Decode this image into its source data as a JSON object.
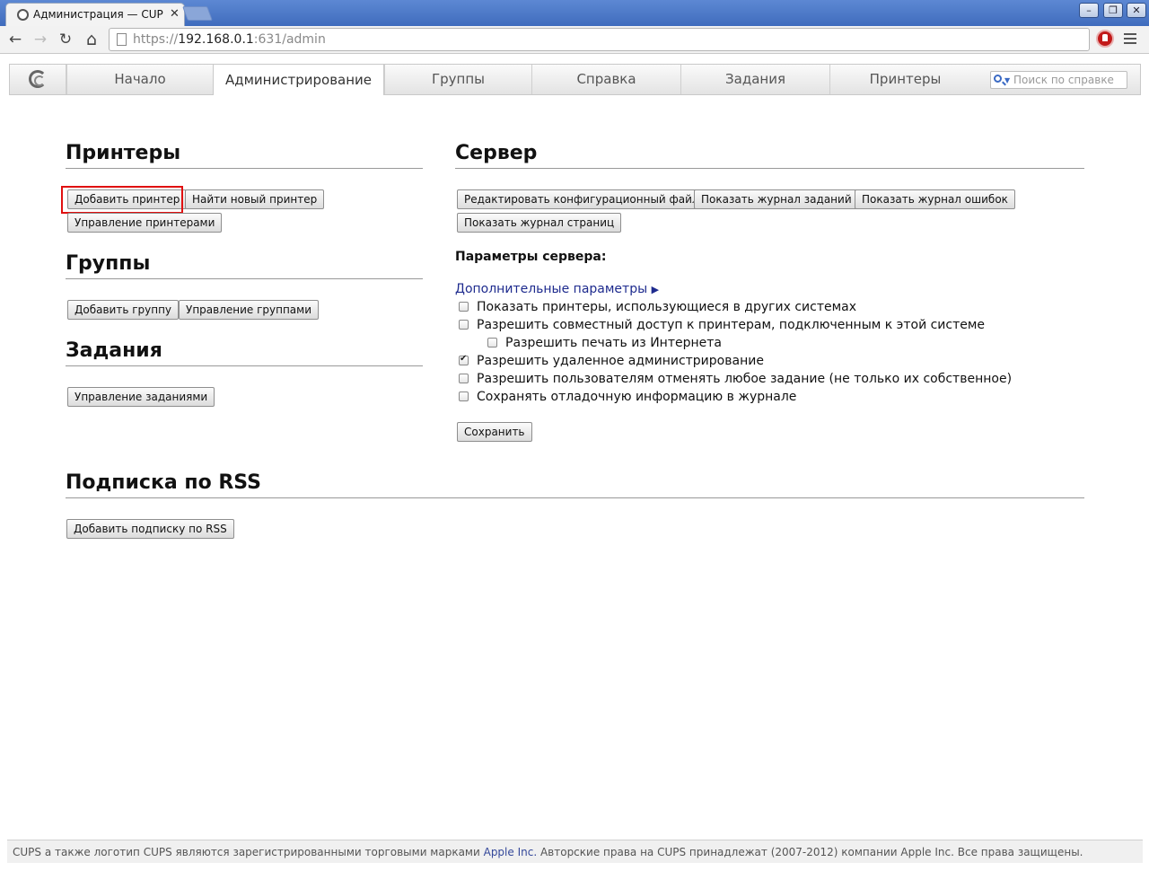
{
  "browser": {
    "tab_title": "Администрация — CUPS",
    "tab_close": "✕",
    "url_scheme": "https://",
    "url_host": "192.168.0.1",
    "url_rest": ":631/admin",
    "window_buttons": {
      "minimize": "–",
      "restore": "❐",
      "close": "✕"
    },
    "nav": {
      "back": "←",
      "forward": "→",
      "reload": "↻",
      "home": "⌂"
    }
  },
  "cups_nav": {
    "tabs": [
      "Начало",
      "Администрирование",
      "Группы",
      "Справка",
      "Задания",
      "Принтеры"
    ],
    "active_tab": "Администрирование",
    "search_placeholder": "Поиск по справке"
  },
  "printers": {
    "heading": "Принтеры",
    "add_printer": "Добавить принтер",
    "find_printer": "Найти новый принтер",
    "manage_printers": "Управление принтерами"
  },
  "classes": {
    "heading": "Группы",
    "add_class": "Добавить группу",
    "manage_classes": "Управление группами"
  },
  "jobs": {
    "heading": "Задания",
    "manage_jobs": "Управление заданиями"
  },
  "server": {
    "heading": "Сервер",
    "edit_config": "Редактировать конфигурационный файл",
    "view_access_log": "Показать журнал заданий",
    "view_error_log": "Показать журнал ошибок",
    "view_page_log": "Показать журнал страниц",
    "settings_title": "Параметры сервера:",
    "advanced_link": "Дополнительные параметры",
    "advanced_arrow": "▶",
    "options": [
      {
        "label": "Показать принтеры, использующиеся в других системах",
        "checked": false
      },
      {
        "label": "Разрешить совместный доступ к принтерам, подключенным к этой системе",
        "checked": false
      },
      {
        "label": "Разрешить печать из Интернета",
        "checked": false
      },
      {
        "label": "Разрешить удаленное администрирование",
        "checked": true
      },
      {
        "label": "Разрешить пользователям отменять любое задание (не только их собственное)",
        "checked": false
      },
      {
        "label": "Сохранять отладочную информацию в журнале",
        "checked": false
      }
    ],
    "save": "Сохранить"
  },
  "rss": {
    "heading": "Подписка по RSS",
    "add_rss": "Добавить подписку по RSS"
  },
  "footer": {
    "text_before": "CUPS а также логотип CUPS являются зарегистрированными торговыми марками ",
    "apple_link": "Apple Inc.",
    "text_after": " Авторские права на CUPS принадлежат (2007-2012) компании Apple Inc. Все права защищены."
  }
}
